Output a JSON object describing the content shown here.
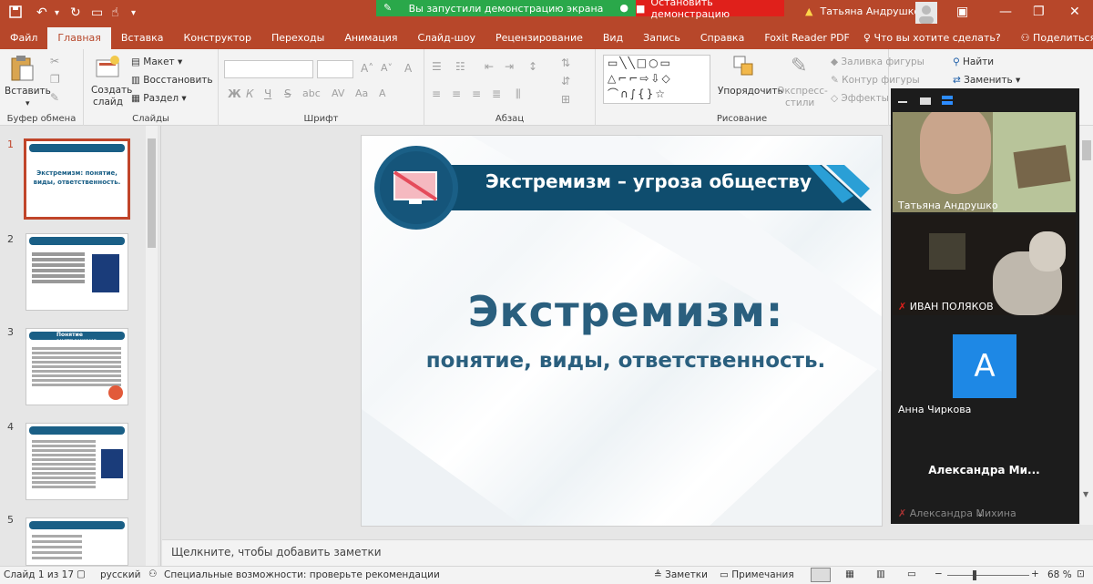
{
  "titlebar": {
    "share_status": "Вы запустили демонстрацию экрана",
    "stop_share": "Остановить демонстрацию",
    "user_name": "Татьяна Андрушко"
  },
  "tabs": [
    "Файл",
    "Главная",
    "Вставка",
    "Конструктор",
    "Переходы",
    "Анимация",
    "Слайд-шоу",
    "Рецензирование",
    "Вид",
    "Запись",
    "Справка",
    "Foxit Reader PDF"
  ],
  "tell_me": "Что вы хотите сделать?",
  "share_label": "Поделиться",
  "ribbon": {
    "clipboard": {
      "paste": "Вставить",
      "label": "Буфер обмена"
    },
    "slides": {
      "new_slide_1": "Создать",
      "new_slide_2": "слайд",
      "layout": "Макет",
      "reset": "Восстановить",
      "section": "Раздел",
      "label": "Слайды"
    },
    "font": {
      "bold": "Ж",
      "italic": "К",
      "underline": "Ч",
      "strike": "S",
      "shadow": "abc",
      "label": "Шрифт"
    },
    "paragraph": {
      "label": "Абзац"
    },
    "drawing": {
      "arrange": "Упорядочить",
      "quick_styles_1": "Экспресс-",
      "quick_styles_2": "стили",
      "fill": "Заливка фигуры",
      "outline": "Контур фигуры",
      "effects": "Эффекты ф",
      "label": "Рисование"
    },
    "editing": {
      "find": "Найти",
      "replace": "Заменить"
    }
  },
  "thumbnails": [
    {
      "num": "1",
      "title": "Экстремизм: понятие, виды, ответственность."
    },
    {
      "num": "2"
    },
    {
      "num": "3",
      "title": "Понятие экстремизма"
    },
    {
      "num": "4"
    },
    {
      "num": "5"
    }
  ],
  "slide": {
    "banner": "Экстремизм – угроза обществу",
    "title": "Экстремизм:",
    "subtitle": "понятие, виды, ответственность."
  },
  "notes_placeholder": "Щелкните, чтобы добавить заметки",
  "video": {
    "p1": "Татьяна Андрушко",
    "p2": "ИВАН ПОЛЯКОВ",
    "p3_initial": "A",
    "p3": "Анна Чиркова",
    "p4": "Александра  Ми...",
    "p5": "Александра Михина"
  },
  "status": {
    "slide": "Слайд 1 из 17",
    "lang": "русский",
    "accessibility": "Специальные возможности: проверьте рекомендации",
    "notes": "Заметки",
    "comments": "Примечания",
    "zoom": "68 %"
  },
  "colors": {
    "brand": "#b7472a",
    "slide_blue": "#1a5f86",
    "share_green": "#2aa84a",
    "share_red": "#e0201b",
    "avatar_blue": "#1e88e5"
  }
}
